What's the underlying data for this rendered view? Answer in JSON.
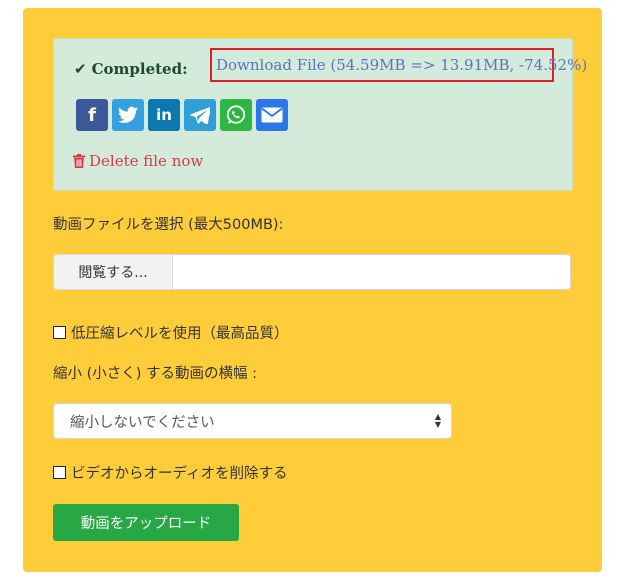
{
  "status": {
    "completed_label": "Completed:",
    "download_link": "Download File (54.59MB => 13.91MB, -74.52%)",
    "delete_link": "Delete file now"
  },
  "share_buttons": [
    {
      "name": "facebook",
      "glyph": "f",
      "color": "#3b5998"
    },
    {
      "name": "twitter",
      "glyph": "t",
      "color": "#33a1e0"
    },
    {
      "name": "linkedin",
      "glyph": "in",
      "color": "#0b78b0"
    },
    {
      "name": "telegram",
      "glyph": "",
      "color": "#2f9fd8"
    },
    {
      "name": "whatsapp",
      "glyph": "",
      "color": "#2bb741"
    },
    {
      "name": "email",
      "glyph": "",
      "color": "#2b77e6"
    }
  ],
  "form": {
    "file_label": "動画ファイルを選択 (最大500MB):",
    "browse_label": "閲覧する...",
    "file_value": "",
    "low_compression_label": "低圧縮レベルを使用（最高品質）",
    "low_compression_checked": false,
    "width_label": "縮小 (小さく) する動画の横幅 :",
    "width_select_value": "縮小しないでください",
    "remove_audio_label": "ビデオからオーディオを削除する",
    "remove_audio_checked": false,
    "upload_button": "動画をアップロード"
  },
  "colors": {
    "panel_bg": "#ffcd3a",
    "alert_bg": "#d4eadb",
    "link": "#5b74c0",
    "danger": "#d63a47",
    "primary_button": "#28a745",
    "highlight_border": "#dd1f26"
  }
}
